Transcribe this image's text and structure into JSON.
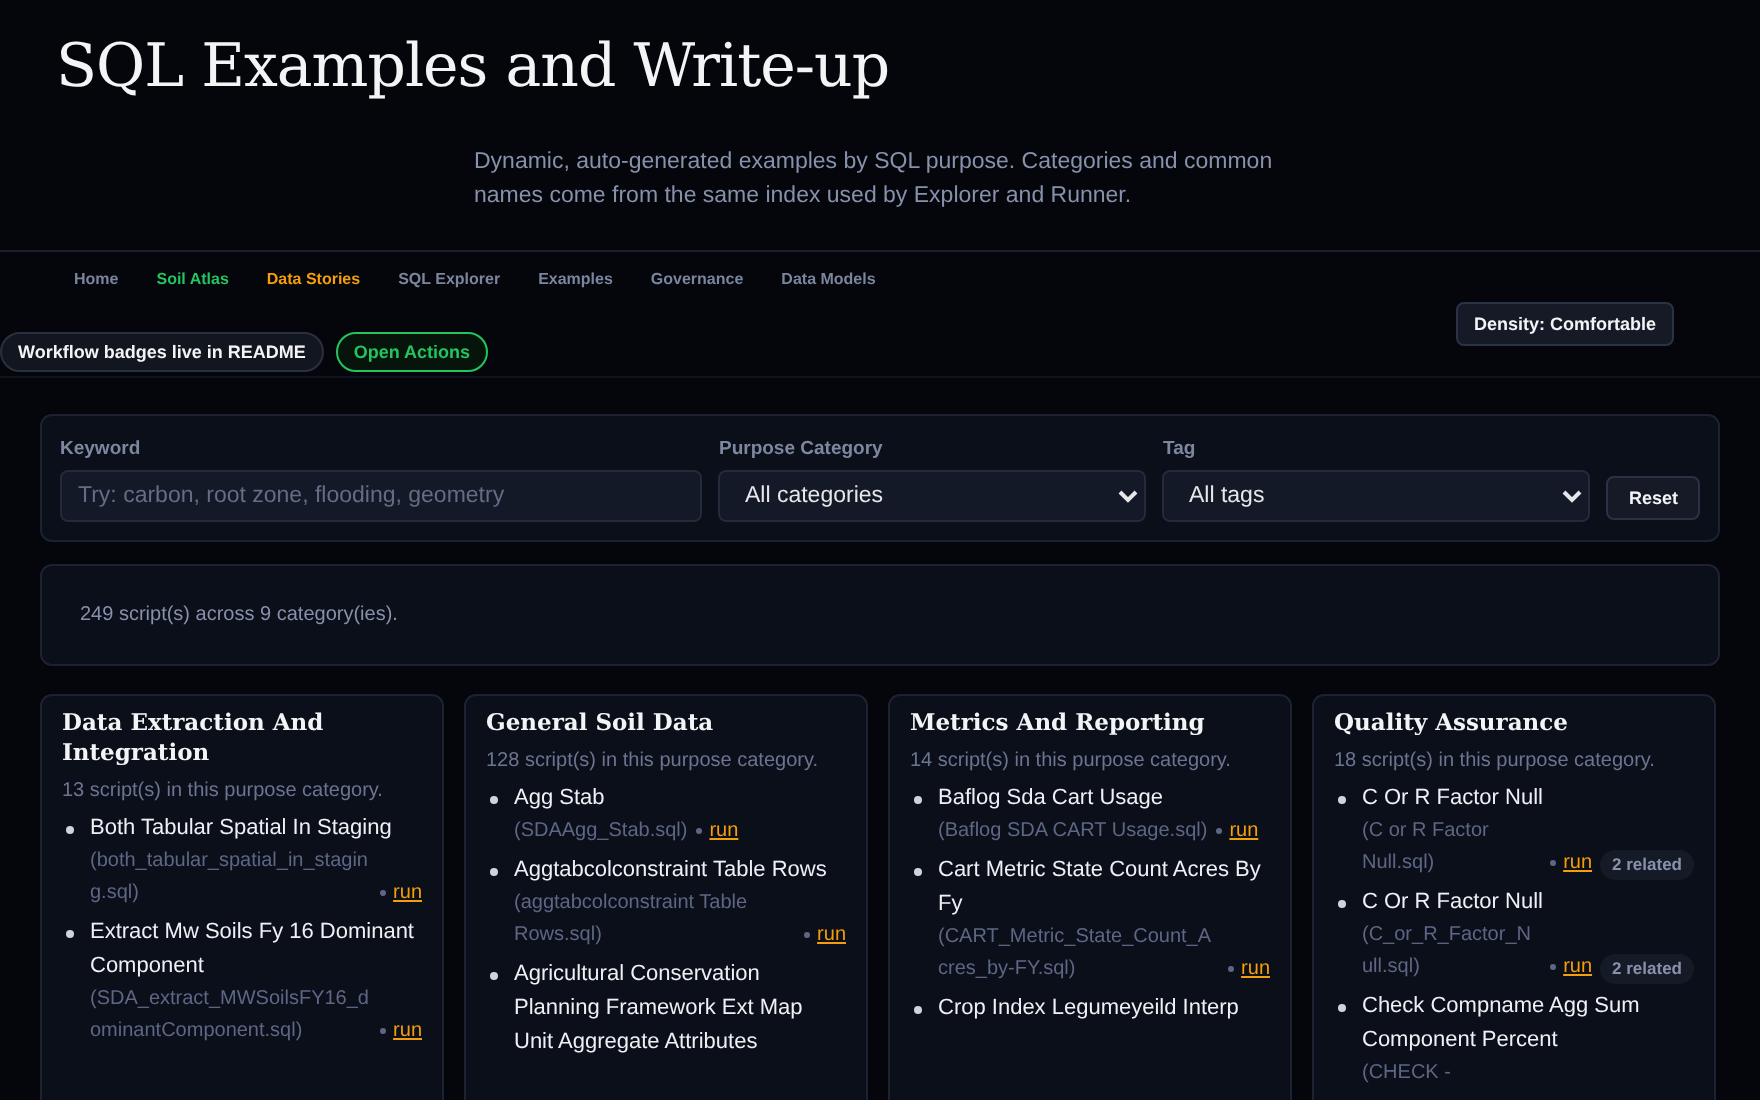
{
  "header": {
    "title": "SQL Examples and Write-up",
    "subtitle": "Dynamic, auto-generated examples by SQL purpose. Categories and common names come from the same index used by Explorer and Runner."
  },
  "nav": [
    {
      "label": "Home",
      "color": "#7b859e"
    },
    {
      "label": "Soil Atlas",
      "color": "#22c55e"
    },
    {
      "label": "Data Stories",
      "color": "#f59e0b"
    },
    {
      "label": "SQL Explorer",
      "color": "#7b859e"
    },
    {
      "label": "Examples",
      "color": "#7b859e"
    },
    {
      "label": "Governance",
      "color": "#7b859e"
    },
    {
      "label": "Data Models",
      "color": "#7b859e"
    }
  ],
  "badges": [
    {
      "label": "Workflow badges live in README",
      "kind": "plain"
    },
    {
      "label": "Open Actions",
      "kind": "action"
    }
  ],
  "density_button": "Density: Comfortable",
  "filters": {
    "keyword": {
      "label": "Keyword",
      "placeholder": "Try: carbon, root zone, flooding, geometry"
    },
    "category": {
      "label": "Purpose Category",
      "value": "All categories"
    },
    "tag": {
      "label": "Tag",
      "value": "All tags"
    },
    "reset": "Reset"
  },
  "summary": "249 script(s) across 9 category(ies).",
  "categories": [
    {
      "title": "Data Extraction And Integration",
      "count": "13 script(s) in this purpose category.",
      "items": [
        {
          "name": "Both Tabular Spatial In Staging",
          "file": "(both_tabular_spatial_in_staging.sql)",
          "link": "run"
        },
        {
          "name": "Extract Mw Soils Fy 16 Dominant Component",
          "file": "(SDA_extract_MWSoilsFY16_dominantComponent.sql)",
          "link": "run"
        }
      ]
    },
    {
      "title": "General Soil Data",
      "count": "128 script(s) in this purpose category.",
      "items": [
        {
          "name": "Agg Stab",
          "file": "(SDAAgg_Stab.sql)",
          "link": "run"
        },
        {
          "name": "Aggtabcolconstraint Table Rows",
          "file": "(aggtabcolconstraint Table Rows.sql)",
          "link": "run"
        },
        {
          "name": "Agricultural Conservation Planning Framework Ext Map Unit Aggregate Attributes"
        }
      ]
    },
    {
      "title": "Metrics And Reporting",
      "count": "14 script(s) in this purpose category.",
      "items": [
        {
          "name": "Baflog Sda Cart Usage",
          "file": "(Baflog SDA CART Usage.sql)",
          "link": "run"
        },
        {
          "name": "Cart Metric State Count Acres By Fy",
          "file": "(CART_Metric_State_Count_Acres_by-FY.sql)",
          "link": "run"
        },
        {
          "name": "Crop Index Legumeyeild Interp"
        }
      ]
    },
    {
      "title": "Quality Assurance",
      "count": "18 script(s) in this purpose category.",
      "items": [
        {
          "name": "C Or R Factor Null",
          "file": "(C or R Factor Null.sql)",
          "link": "run",
          "related": "2 related"
        },
        {
          "name": "C Or R Factor Null",
          "file": "(C_or_R_Factor_Null.sql)",
          "link": "run",
          "related": "2 related"
        },
        {
          "name": "Check Compname Agg Sum Component Percent",
          "file": "(CHECK -"
        }
      ]
    }
  ]
}
